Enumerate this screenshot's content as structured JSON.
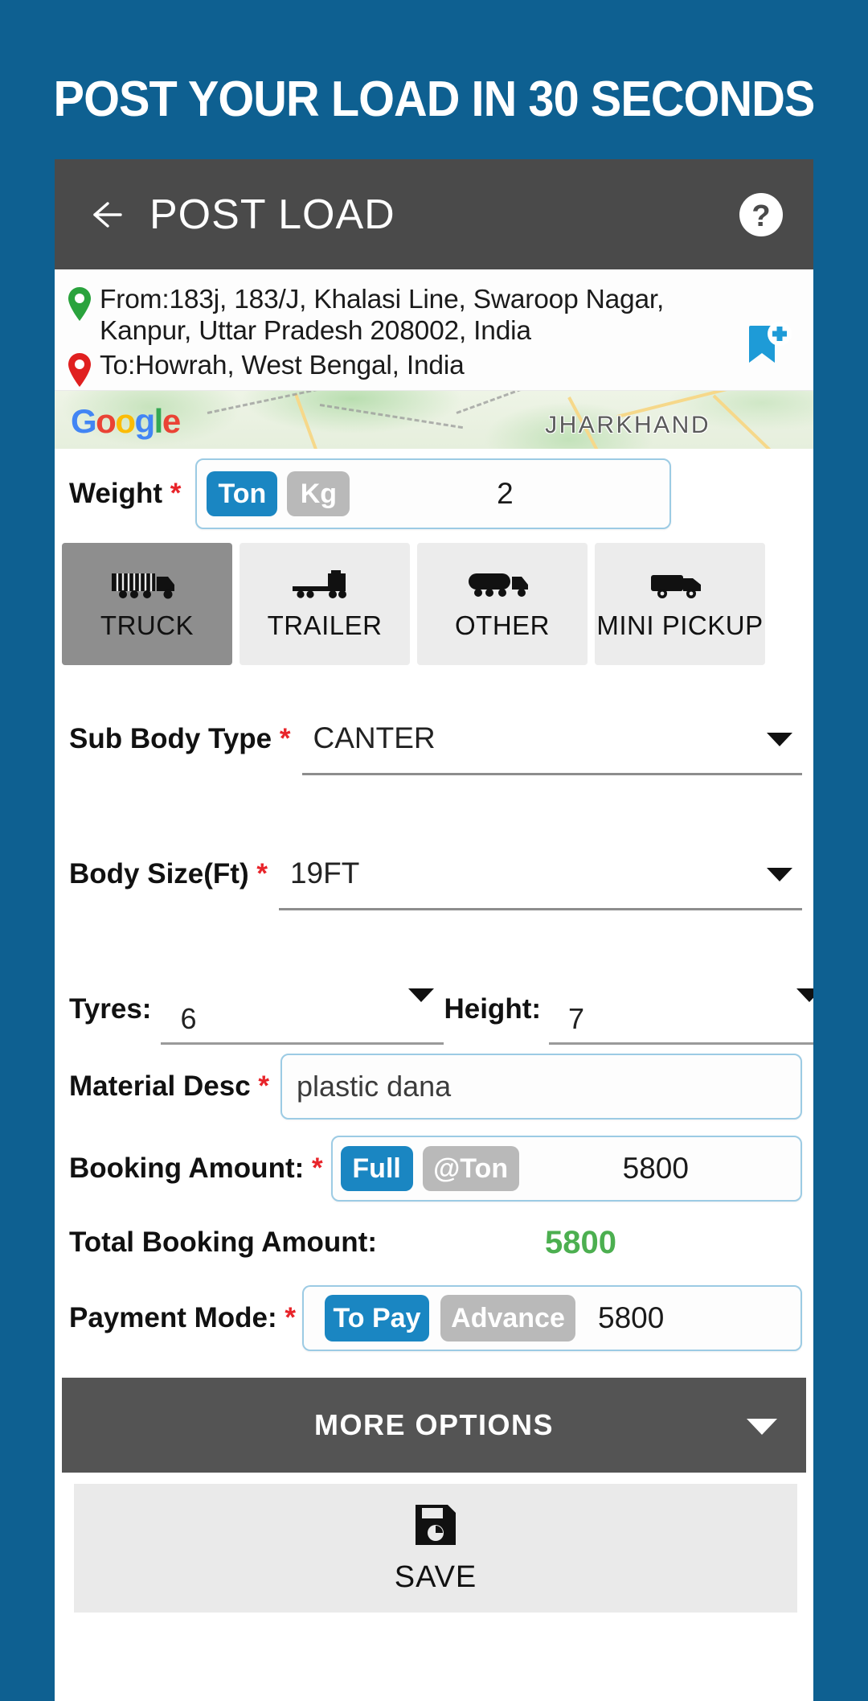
{
  "promo": {
    "headline": "POST YOUR LOAD IN 30 SECONDS"
  },
  "colors": {
    "page_background": "#0e6091",
    "appbar": "#4a4a4a",
    "accent_blue": "#1a86c2",
    "chip_inactive": "#b9b9b9",
    "required_red": "#e8242a",
    "total_green": "#4caf50",
    "tab_selected": "#8e8e8e",
    "tab_unselected": "#ececec",
    "more_options_bar": "#545454"
  },
  "appbar": {
    "back_icon": "arrow-left-icon",
    "title": "POST LOAD",
    "help_icon": "help-circle-icon"
  },
  "route": {
    "from_icon": "map-pin-green-icon",
    "from_text": "From:183j, 183/J, Khalasi Line, Swaroop Nagar, Kanpur, Uttar Pradesh 208002, India",
    "to_icon": "map-pin-red-icon",
    "to_text": "To:Howrah, West Bengal, India",
    "bookmark_icon": "bookmark-add-icon"
  },
  "map": {
    "logo_letters": [
      "G",
      "o",
      "o",
      "g",
      "l",
      "e"
    ],
    "logo_colors": [
      "#4285F4",
      "#EA4335",
      "#FBBC05",
      "#4285F4",
      "#34A853",
      "#EA4335"
    ],
    "region_label": "JHARKHAND"
  },
  "weight": {
    "label": "Weight",
    "required": "*",
    "unit_ton": "Ton",
    "unit_kg": "Kg",
    "selected_unit": "Ton",
    "value": "2"
  },
  "vehicle_tabs": [
    {
      "label": "TRUCK",
      "icon": "truck-container-icon",
      "selected": true
    },
    {
      "label": "TRAILER",
      "icon": "trailer-icon",
      "selected": false
    },
    {
      "label": "OTHER",
      "icon": "tanker-truck-icon",
      "selected": false
    },
    {
      "label": "MINI PICKUP",
      "icon": "mini-pickup-icon",
      "selected": false
    }
  ],
  "sub_body_type": {
    "label": "Sub Body Type",
    "required": "*",
    "value": "CANTER",
    "caret_icon": "chevron-down-icon"
  },
  "body_size": {
    "label": "Body Size(Ft)",
    "required": "*",
    "value": "19FT",
    "caret_icon": "chevron-down-icon"
  },
  "tyres": {
    "label": "Tyres:",
    "value": "6",
    "caret_icon": "chevron-down-icon"
  },
  "height": {
    "label": "Height:",
    "value": "7",
    "caret_icon": "chevron-down-icon"
  },
  "material_desc": {
    "label": "Material Desc",
    "required": "*",
    "value": "plastic dana"
  },
  "booking_amount": {
    "label": "Booking Amount:",
    "required": "*",
    "option_full": "Full",
    "option_per_ton": "@Ton",
    "selected_option": "Full",
    "value": "5800"
  },
  "total_booking_amount": {
    "label": "Total Booking Amount:",
    "value": "5800"
  },
  "payment_mode": {
    "label": "Payment Mode:",
    "required": "*",
    "option_to_pay": "To Pay",
    "option_advance": "Advance",
    "selected_option": "To Pay",
    "value": "5800"
  },
  "more_options": {
    "label": "MORE OPTIONS",
    "caret_icon": "chevron-down-icon"
  },
  "save": {
    "icon": "floppy-save-icon",
    "label": "SAVE"
  }
}
